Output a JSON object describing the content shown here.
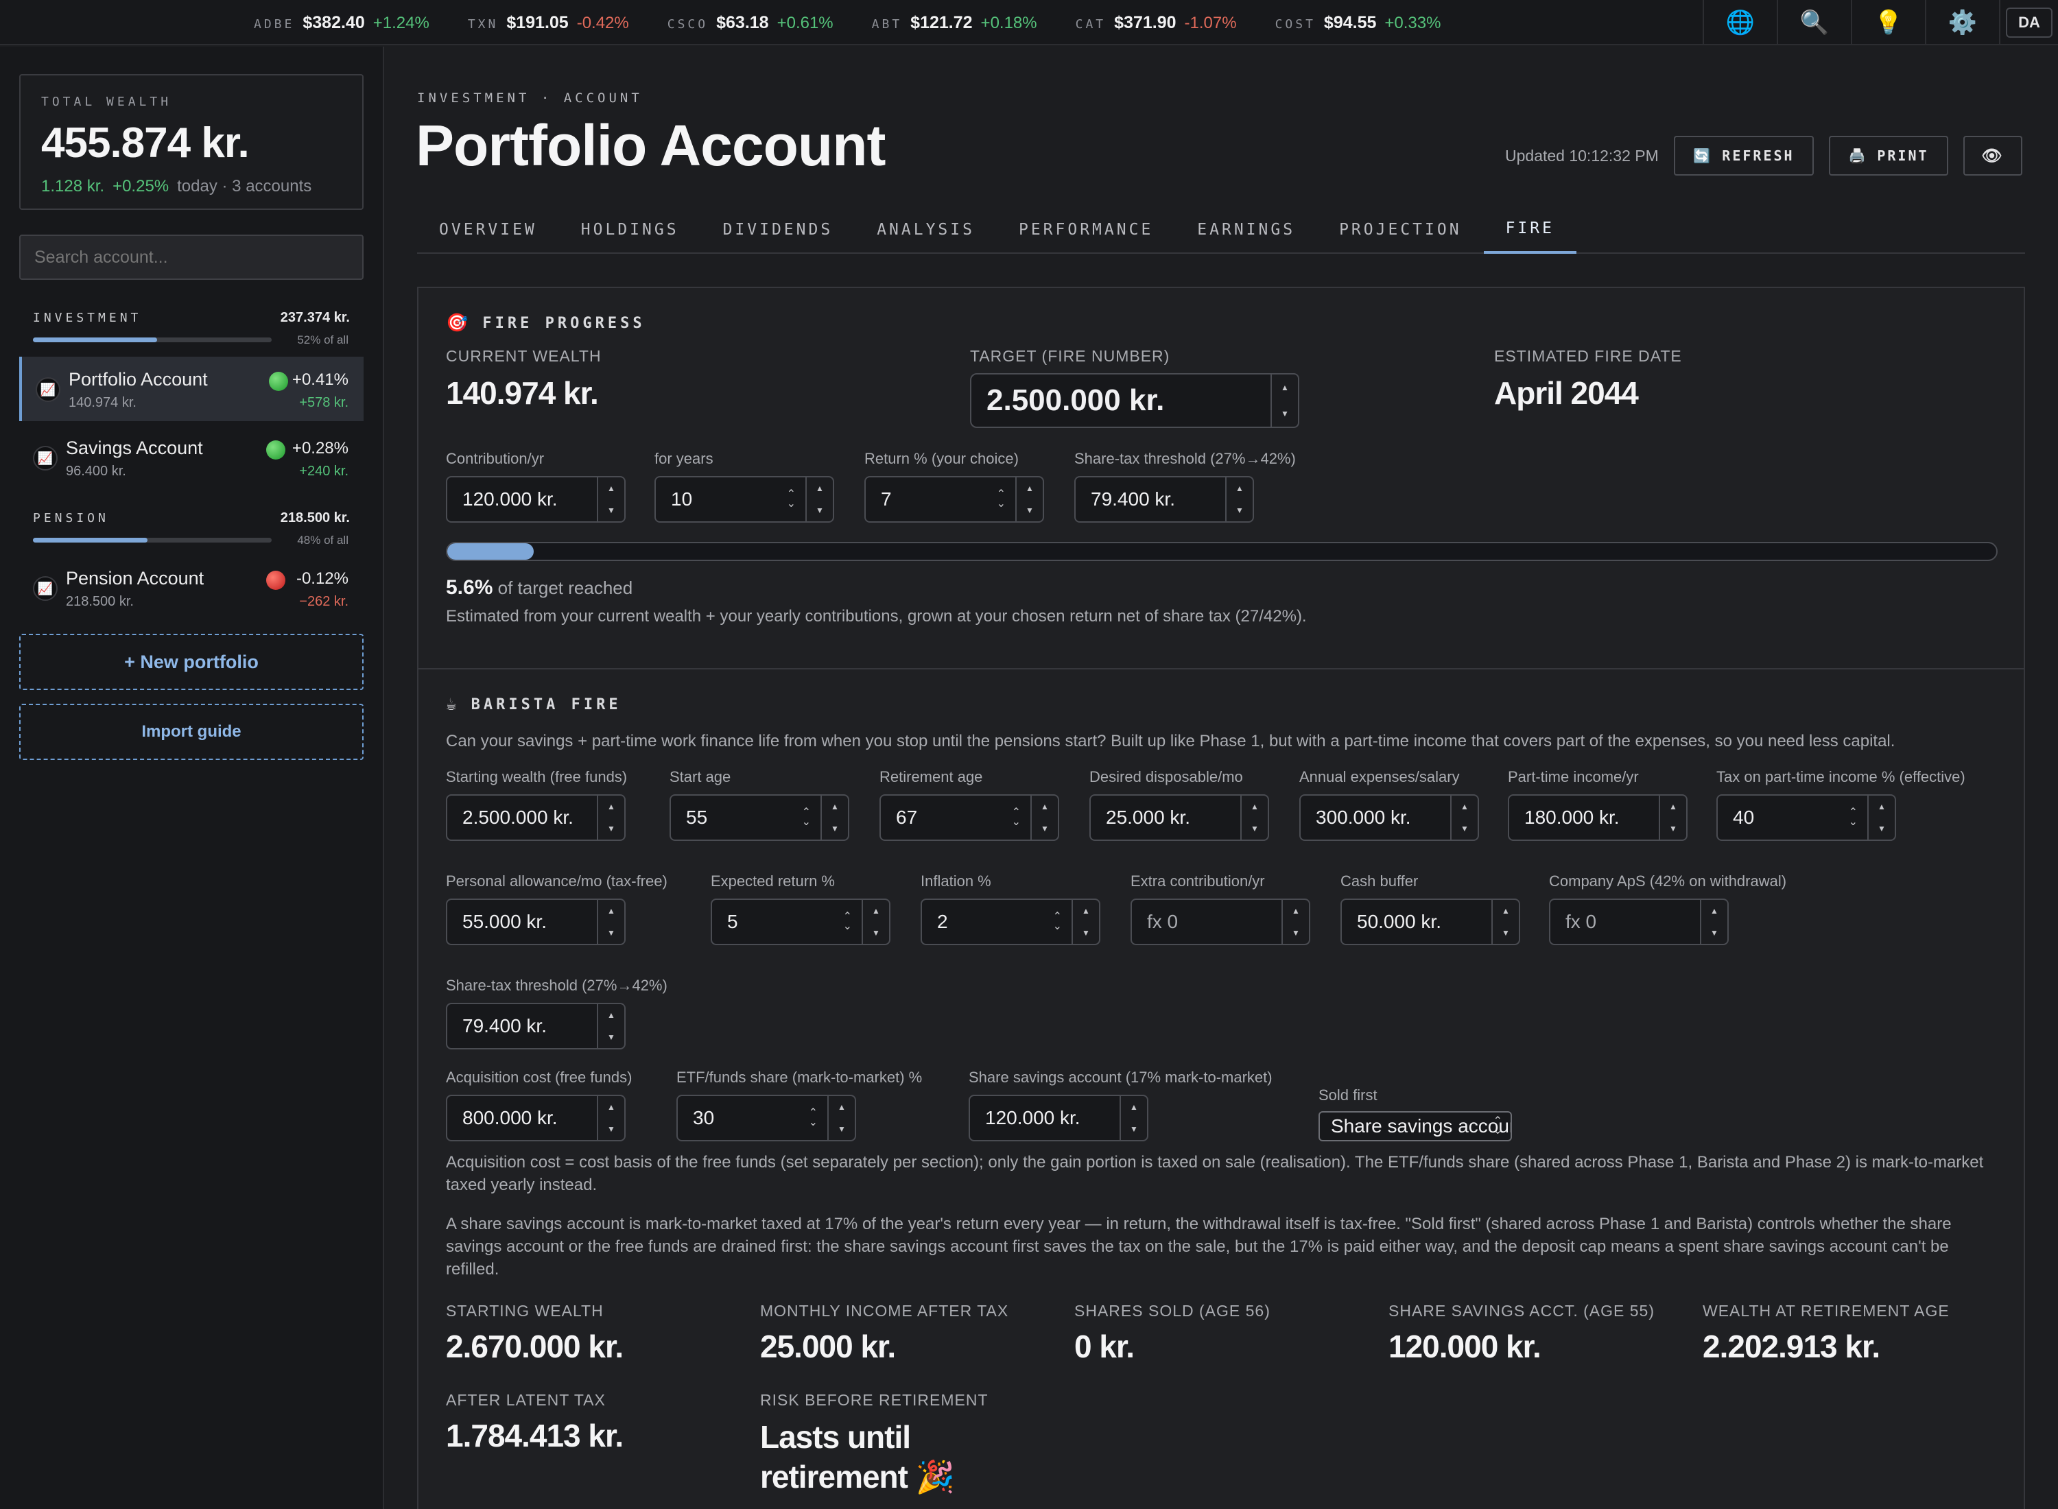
{
  "ticker": [
    {
      "sym": "ADBE",
      "price": "$382.40",
      "change": "+1.24%",
      "dir": "pos"
    },
    {
      "sym": "TXN",
      "price": "$191.05",
      "change": "-0.42%",
      "dir": "neg"
    },
    {
      "sym": "CSCO",
      "price": "$63.18",
      "change": "+0.61%",
      "dir": "pos"
    },
    {
      "sym": "ABT",
      "price": "$121.72",
      "change": "+0.18%",
      "dir": "pos"
    },
    {
      "sym": "CAT",
      "price": "$371.90",
      "change": "-1.07%",
      "dir": "neg"
    },
    {
      "sym": "COST",
      "price": "$94.55",
      "change": "+0.33%",
      "dir": "pos"
    }
  ],
  "header_icons": {
    "globe": "🌐",
    "search": "🔍",
    "bulb": "💡",
    "gear": "⚙️",
    "avatar": "DA"
  },
  "sidebar": {
    "total_label": "TOTAL WEALTH",
    "total_value": "455.874 kr.",
    "total_change_amount": "1.128 kr.",
    "total_change_pct": "+0.25%",
    "total_meta": "today · 3 accounts",
    "search_placeholder": "Search account...",
    "groups": [
      {
        "name": "INVESTMENT",
        "amount": "237.374 kr.",
        "share": "52% of all",
        "share_fraction": 0.52
      },
      {
        "name": "PENSION",
        "amount": "218.500 kr.",
        "share": "48% of all",
        "share_fraction": 0.48
      }
    ],
    "accounts": [
      {
        "name": "Portfolio Account",
        "balance": "140.974 kr.",
        "pct": "+0.41%",
        "change": "+578 kr.",
        "status": "green"
      },
      {
        "name": "Savings Account",
        "balance": "96.400 kr.",
        "pct": "+0.28%",
        "change": "+240 kr.",
        "status": "green"
      },
      {
        "name": "Pension Account",
        "balance": "218.500 kr.",
        "pct": "-0.12%",
        "change": "−262 kr.",
        "status": "red"
      }
    ],
    "new_portfolio": "+ New portfolio",
    "import_guide": "Import guide"
  },
  "page": {
    "crumb": "INVESTMENT · ACCOUNT",
    "title": "Portfolio Account",
    "updated": "Updated 10:12:32 PM",
    "refresh": "REFRESH",
    "print": "PRINT",
    "eye_icon": "👁",
    "refresh_icon": "🔄",
    "print_icon": "🖨️"
  },
  "tabs": [
    "OVERVIEW",
    "HOLDINGS",
    "DIVIDENDS",
    "ANALYSIS",
    "PERFORMANCE",
    "EARNINGS",
    "PROJECTION",
    "FIRE"
  ],
  "active_tab": "FIRE",
  "fire": {
    "title": "FIRE PROGRESS",
    "icon": "🎯",
    "current_wealth_label": "CURRENT WEALTH",
    "current_wealth": "140.974 kr.",
    "target_label": "TARGET (FIRE NUMBER)",
    "target_value": "2.500.000 kr.",
    "est_date_label": "ESTIMATED FIRE DATE",
    "est_date": "April 2044",
    "contribution_label": "Contribution/yr",
    "contribution_value": "120.000 kr.",
    "years_label": "for years",
    "years_value": "10",
    "return_label": "Return % (your choice)",
    "return_value": "7",
    "threshold_label": "Share-tax threshold (27%→42%)",
    "threshold_value": "79.400 kr.",
    "progress_fraction": 0.056,
    "progress_pct": "5.6%",
    "progress_text": "of target reached",
    "note": "Estimated from your current wealth + your yearly contributions, grown at your chosen return net of share tax (27/42%)."
  },
  "barista": {
    "title": "BARISTA FIRE",
    "icon": "☕",
    "intro": "Can your savings + part-time work finance life from when you stop until the pensions start? Built up like Phase 1, but with a part-time income that covers part of the expenses, so you need less capital.",
    "row1": [
      {
        "label": "Starting wealth (free funds)",
        "value": "2.500.000 kr."
      },
      {
        "label": "Start age",
        "value": "55"
      },
      {
        "label": "Retirement age",
        "value": "67"
      },
      {
        "label": "Desired disposable/mo",
        "value": "25.000 kr."
      },
      {
        "label": "Annual expenses/salary",
        "value": "300.000 kr."
      },
      {
        "label": "Part-time income/yr",
        "value": "180.000 kr."
      },
      {
        "label": "Tax on part-time income % (effective)",
        "value": "40"
      }
    ],
    "row2": [
      {
        "label": "Personal allowance/mo (tax-free)",
        "value": "55.000 kr."
      },
      {
        "label": "Expected return %",
        "value": "5"
      },
      {
        "label": "Inflation %",
        "value": "2"
      },
      {
        "label": "Extra contribution/yr",
        "value": "fx 0"
      },
      {
        "label": "Cash buffer",
        "value": "50.000 kr."
      },
      {
        "label": "Company ApS (42% on withdrawal)",
        "value": "fx 0"
      }
    ],
    "row3": [
      {
        "label": "Share-tax threshold (27%→42%)",
        "value": "79.400 kr."
      }
    ],
    "row4": [
      {
        "label": "Acquisition cost (free funds)",
        "value": "800.000 kr."
      },
      {
        "label": "ETF/funds share (mark-to-market) %",
        "value": "30"
      },
      {
        "label": "Share savings account (17% mark-to-market)",
        "value": "120.000 kr."
      }
    ],
    "sold_first_label": "Sold first",
    "sold_first_value": "Share savings account",
    "note1": "Acquisition cost = cost basis of the free funds (set separately per section); only the gain portion is taxed on sale (realisation). The ETF/funds share (shared across Phase 1, Barista and Phase 2) is mark-to-market taxed yearly instead.",
    "note2": "A share savings account is mark-to-market taxed at 17% of the year's return every year — in return, the withdrawal itself is tax-free. \"Sold first\" (shared across Phase 1 and Barista) controls whether the share savings account or the free funds are drained first: the share savings account first saves the tax on the sale, but the 17% is paid either way, and the deposit cap means a spent share savings account can't be refilled.",
    "results": [
      {
        "label": "STARTING WEALTH",
        "value": "2.670.000 kr."
      },
      {
        "label": "MONTHLY INCOME AFTER TAX",
        "value": "25.000 kr."
      },
      {
        "label": "SHARES SOLD (AGE 56)",
        "value": "0 kr."
      },
      {
        "label": "SHARE SAVINGS ACCT. (AGE 55)",
        "value": "120.000 kr."
      },
      {
        "label": "WEALTH AT RETIREMENT AGE",
        "value": "2.202.913 kr."
      },
      {
        "label": "AFTER LATENT TAX",
        "value": "1.784.413 kr."
      },
      {
        "label": "RISK BEFORE RETIREMENT",
        "value": "Lasts until retirement 🎉"
      }
    ]
  }
}
